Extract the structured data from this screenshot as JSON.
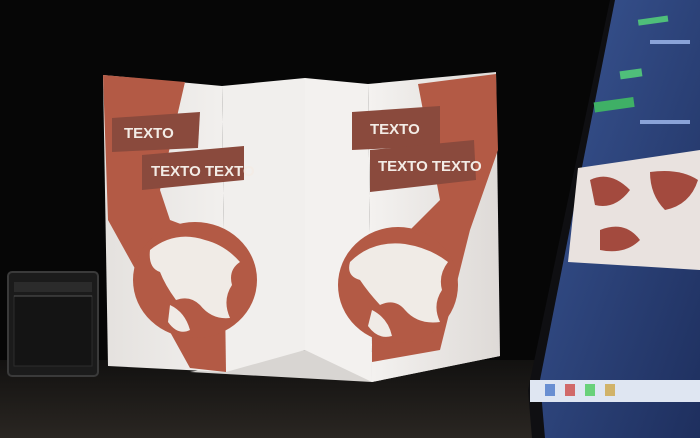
{
  "scene": {
    "description_labels": {
      "left_tag_1": "TEXTO",
      "left_tag_2": "TEXTO TEXTO",
      "right_tag_1": "TEXTO",
      "right_tag_2": "TEXTO TEXTO"
    },
    "colors": {
      "background": "#060606",
      "screen_white": "#ece9e6",
      "projection_red": "#b35a45",
      "banner_brown": "#8a4a3d",
      "laptop_blue": "#2a3f78",
      "floor": "#1c1a18"
    }
  }
}
